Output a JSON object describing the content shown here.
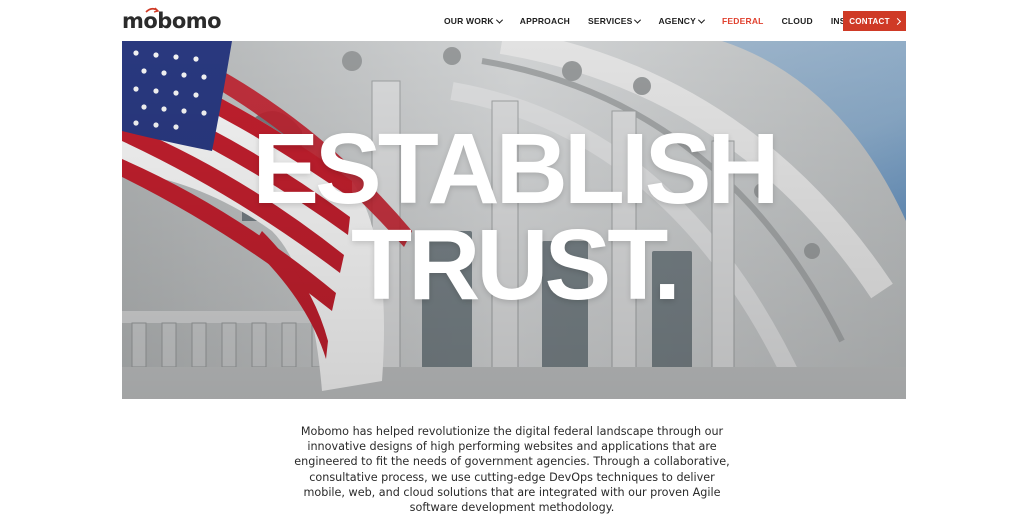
{
  "brand": {
    "logo_text": "mobomo",
    "accent": "#cf3a26"
  },
  "nav": {
    "items": [
      {
        "label": "OUR WORK",
        "dropdown": true,
        "active": false
      },
      {
        "label": "APPROACH",
        "dropdown": false,
        "active": false
      },
      {
        "label": "SERVICES",
        "dropdown": true,
        "active": false
      },
      {
        "label": "AGENCY",
        "dropdown": true,
        "active": false
      },
      {
        "label": "FEDERAL",
        "dropdown": false,
        "active": true
      },
      {
        "label": "CLOUD",
        "dropdown": false,
        "active": false
      },
      {
        "label": "INSIGHTS",
        "dropdown": false,
        "active": false
      }
    ],
    "contact_label": "CONTACT"
  },
  "hero": {
    "title_line1": "ESTABLISH",
    "title_line2": "TRUST.",
    "image_subject": "us-capitol-with-american-flag"
  },
  "intro": {
    "text": "Mobomo has helped revolutionize the digital federal landscape through our innovative designs of high performing websites and applications that are engineered to fit the needs of government agencies. Through a collaborative, consultative process, we use cutting-edge DevOps techniques to deliver mobile, web, and cloud solutions that are integrated with our proven Agile software development methodology."
  }
}
